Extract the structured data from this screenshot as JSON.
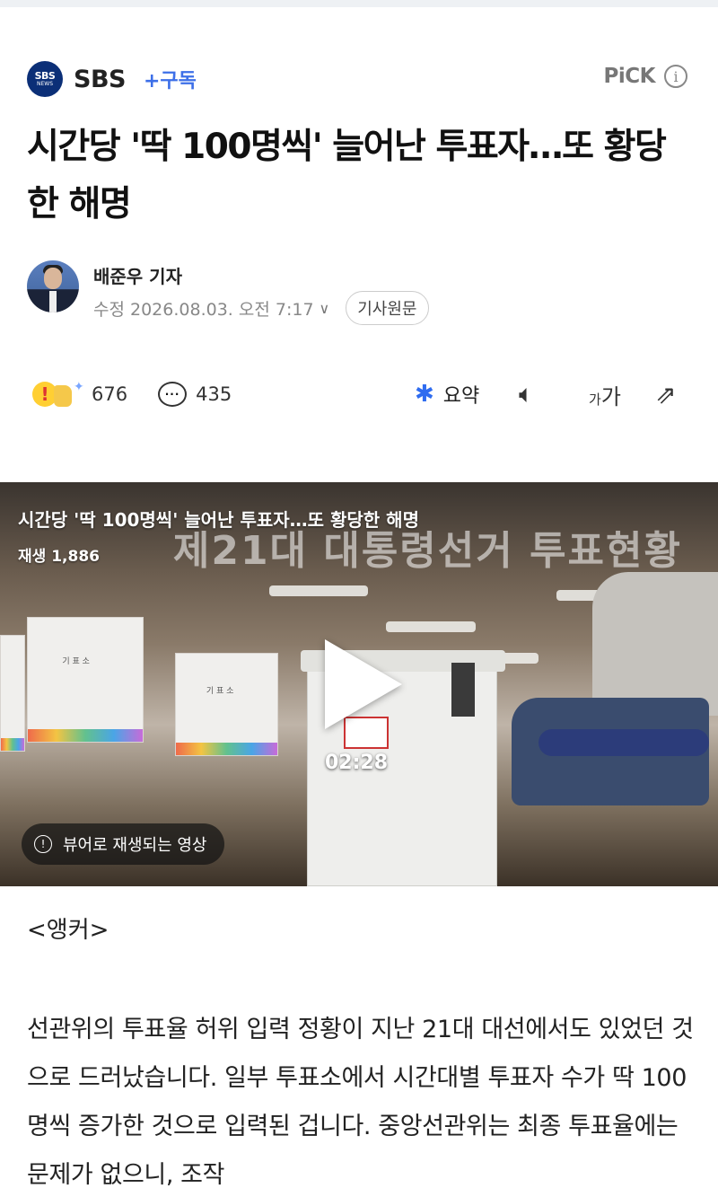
{
  "press": {
    "logo_line1": "SBS",
    "logo_line2": "NEWS",
    "name": "SBS",
    "subscribe_label": "+구독",
    "pick_label": "PiCK",
    "info_glyph": "i"
  },
  "article": {
    "headline": "시간당 '딱 100명씩' 늘어난 투표자…또 황당한 해명",
    "reporter": "배준우 기자",
    "meta_text": "수정 2026.08.03. 오전 7:17",
    "original_button": "기사원문"
  },
  "actions": {
    "reaction_count": "676",
    "comment_count": "435",
    "summary_label": "요약",
    "fontsize_small": "가",
    "fontsize_big": "가"
  },
  "video": {
    "title": "시간당 '딱 100명씩' 늘어난 투표자…또 황당한 해명",
    "plays": "재생 1,886",
    "duration": "02:28",
    "viewer_notice": "뷰어로 재생되는 영상",
    "overlay_text": "제21대 대통령선거 투표현황"
  },
  "content": {
    "anchor": "<앵커>",
    "paragraph": "선관위의 투표율 허위 입력 정황이 지난 21대 대선에서도 있었던 것으로 드러났습니다. 일부 투표소에서 시간대별 투표자 수가 딱 100명씩 증가한 것으로 입력된 겁니다. 중앙선관위는 최종 투표율에는 문제가 없으니, 조작"
  },
  "colors": {
    "accent": "#3d6fe8",
    "logo_bg": "#0b2f77",
    "summary_icon": "#2f6cf0"
  }
}
